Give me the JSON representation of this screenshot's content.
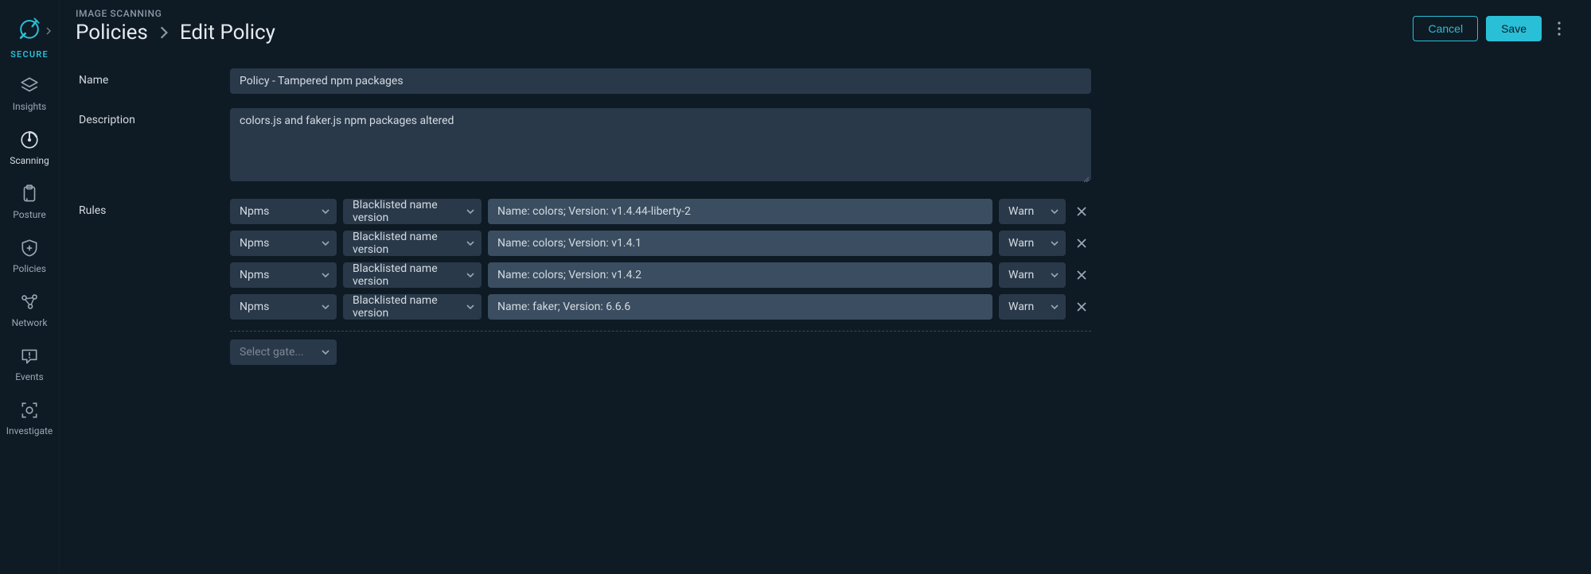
{
  "brand": "SECURE",
  "sidebar": {
    "items": [
      {
        "label": "Insights"
      },
      {
        "label": "Scanning"
      },
      {
        "label": "Posture"
      },
      {
        "label": "Policies"
      },
      {
        "label": "Network"
      },
      {
        "label": "Events"
      },
      {
        "label": "Investigate"
      }
    ]
  },
  "header": {
    "section": "IMAGE SCANNING",
    "breadcrumb_root": "Policies",
    "page_title": "Edit Policy",
    "cancel_label": "Cancel",
    "save_label": "Save"
  },
  "form": {
    "name_label": "Name",
    "name_value": "Policy - Tampered npm packages",
    "description_label": "Description",
    "description_value": "colors.js and faker.js npm packages altered",
    "rules_label": "Rules",
    "add_gate_placeholder": "Select gate...",
    "rules": [
      {
        "gate": "Npms",
        "trigger": "Blacklisted name version",
        "value": "Name: colors; Version: v1.4.44-liberty-2",
        "action": "Warn"
      },
      {
        "gate": "Npms",
        "trigger": "Blacklisted name version",
        "value": "Name: colors; Version: v1.4.1",
        "action": "Warn"
      },
      {
        "gate": "Npms",
        "trigger": "Blacklisted name version",
        "value": "Name: colors; Version: v1.4.2",
        "action": "Warn"
      },
      {
        "gate": "Npms",
        "trigger": "Blacklisted name version",
        "value": "Name: faker; Version: 6.6.6",
        "action": "Warn"
      }
    ]
  },
  "colors": {
    "accent": "#29c0d7",
    "bg": "#0e1a24",
    "panel": "#29394a",
    "panel_light": "#3b4d60"
  }
}
